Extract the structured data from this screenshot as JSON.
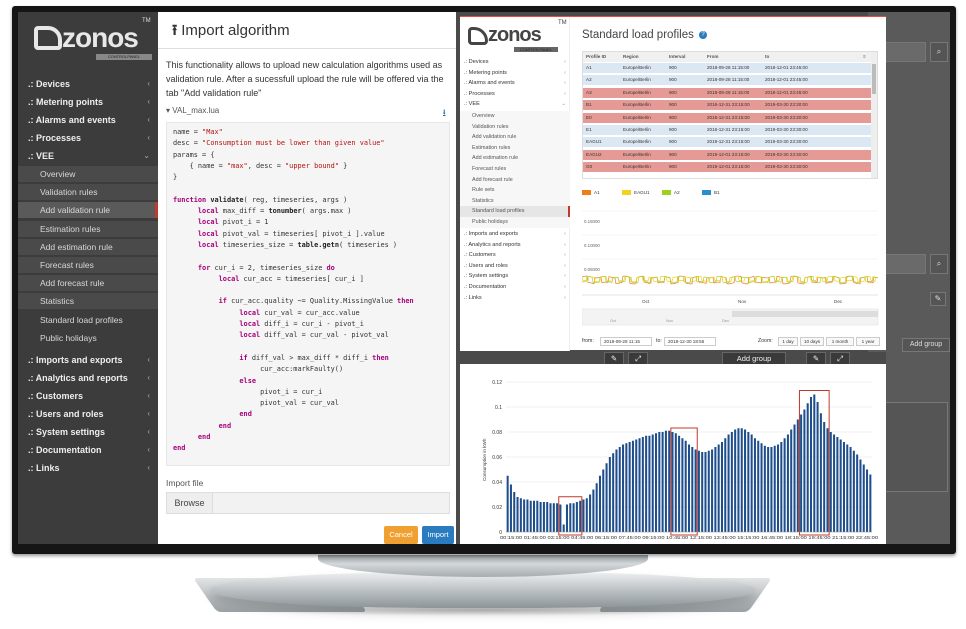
{
  "sidebar": {
    "brand": "zonos",
    "tm": "TM",
    "brand_sub": "CONTROLPANEL",
    "groups": [
      {
        "label": "Devices"
      },
      {
        "label": "Metering points"
      },
      {
        "label": "Alarms and events"
      },
      {
        "label": "Processes"
      },
      {
        "label": "VEE"
      }
    ],
    "vee_items": [
      "Overview",
      "Validation rules",
      "Add validation rule",
      "Estimation rules",
      "Add estimation rule",
      "Forecast rules",
      "Add forecast rule",
      "Statistics",
      "Standard load profiles",
      "Public holidays"
    ],
    "lower_groups": [
      "Imports and exports",
      "Analytics and reports",
      "Customers",
      "Users and roles",
      "System settings",
      "Documentation",
      "Links"
    ]
  },
  "modal": {
    "title": "Import algorithm",
    "description": "This functionality allows to upload new calculation algorithms used as validation rule. After a sucessfull upload the rule will be offered via the tab \"Add validation rule\"",
    "file_name": "VAL_max.lua",
    "import_file_label": "Import file",
    "browse_label": "Browse",
    "cancel_label": "Cancel",
    "import_label": "Import"
  },
  "code_lines": [
    [
      [
        "",
        "name = "
      ],
      [
        "st",
        "\"Max\""
      ]
    ],
    [
      [
        "",
        "desc = "
      ],
      [
        "st",
        "\"Consumption must be lower than given value\""
      ]
    ],
    [
      [
        "",
        "params = {"
      ]
    ],
    [
      [
        "",
        "    { name = "
      ],
      [
        "st",
        "\"max\""
      ],
      [
        "",
        ", desc = "
      ],
      [
        "st",
        "\"upper bound\""
      ],
      [
        "",
        " }"
      ]
    ],
    [
      [
        "",
        "}"
      ]
    ],
    [
      [
        "",
        ""
      ]
    ],
    [
      [
        "kw",
        "function "
      ],
      [
        "fn",
        "validate"
      ],
      [
        "",
        "( reg, timeseries, args )"
      ]
    ],
    [
      [
        "",
        "      "
      ],
      [
        "kw",
        "local"
      ],
      [
        "",
        " max_diff = "
      ],
      [
        "fn",
        "tonumber"
      ],
      [
        "",
        "( args.max )"
      ]
    ],
    [
      [
        "",
        "      "
      ],
      [
        "kw",
        "local"
      ],
      [
        "",
        " pivot_i = 1"
      ]
    ],
    [
      [
        "",
        "      "
      ],
      [
        "kw",
        "local"
      ],
      [
        "",
        " pivot_val = timeseries[ pivot_i ].value"
      ]
    ],
    [
      [
        "",
        "      "
      ],
      [
        "kw",
        "local"
      ],
      [
        "",
        " timeseries_size = "
      ],
      [
        "fn",
        "table.getn"
      ],
      [
        "",
        "( timeseries )"
      ]
    ],
    [
      [
        "",
        ""
      ]
    ],
    [
      [
        "",
        "      "
      ],
      [
        "kw",
        "for"
      ],
      [
        "",
        " cur_i = 2, timeseries_size "
      ],
      [
        "kw",
        "do"
      ]
    ],
    [
      [
        "",
        "           "
      ],
      [
        "kw",
        "local"
      ],
      [
        "",
        " cur_acc = timeseries[ cur_i ]"
      ]
    ],
    [
      [
        "",
        ""
      ]
    ],
    [
      [
        "",
        "           "
      ],
      [
        "kw",
        "if"
      ],
      [
        "",
        " cur_acc.quality ~= Quality.MissingValue "
      ],
      [
        "kw",
        "then"
      ]
    ],
    [
      [
        "",
        "                "
      ],
      [
        "kw",
        "local"
      ],
      [
        "",
        " cur_val = cur_acc.value"
      ]
    ],
    [
      [
        "",
        "                "
      ],
      [
        "kw",
        "local"
      ],
      [
        "",
        " diff_i = cur_i - pivot_i"
      ]
    ],
    [
      [
        "",
        "                "
      ],
      [
        "kw",
        "local"
      ],
      [
        "",
        " diff_val = cur_val - pivot_val"
      ]
    ],
    [
      [
        "",
        ""
      ]
    ],
    [
      [
        "",
        "                "
      ],
      [
        "kw",
        "if"
      ],
      [
        "",
        " diff_val > max_diff * diff_i "
      ],
      [
        "kw",
        "then"
      ]
    ],
    [
      [
        "",
        "                     cur_acc:markFaulty()"
      ]
    ],
    [
      [
        "",
        "                "
      ],
      [
        "kw",
        "else"
      ]
    ],
    [
      [
        "",
        "                     pivot_i = cur_i"
      ]
    ],
    [
      [
        "",
        "                     pivot_val = cur_val"
      ]
    ],
    [
      [
        "",
        "                "
      ],
      [
        "kw",
        "end"
      ]
    ],
    [
      [
        "",
        "           "
      ],
      [
        "kw",
        "end"
      ]
    ],
    [
      [
        "",
        "      "
      ],
      [
        "kw",
        "end"
      ]
    ],
    [
      [
        "kw",
        "end"
      ]
    ]
  ],
  "slp": {
    "brand": "zonos",
    "brand_sub": "CONTROLPANEL",
    "title": "Standard load profiles",
    "info_glyph": "?",
    "menu_glyph": "≡",
    "nav": [
      "Devices",
      "Metering points",
      "Alarms and events",
      "Processes",
      "VEE"
    ],
    "vee_items": [
      "Overview",
      "Validation rules",
      "Add validation rule",
      "Estimation rules",
      "Add estimation rule",
      "Forecast rules",
      "Add forecast rule",
      "Rule sets",
      "Statistics",
      "Standard load profiles",
      "Public holidays"
    ],
    "lower_nav": [
      "Imports and exports",
      "Analytics and reports",
      "Customers",
      "Users and roles",
      "System settings",
      "Documentation",
      "Links"
    ],
    "table_headers": [
      "Profile ID",
      "Region",
      "Interval",
      "From",
      "to"
    ],
    "rows": [
      {
        "id": "A1",
        "region": "Europe/Berlin",
        "interval": "900",
        "from": "2018-09-28 11:15:00",
        "to": "2018-12-01 23:45:00",
        "color": "blue"
      },
      {
        "id": "A2",
        "region": "Europe/Berlin",
        "interval": "900",
        "from": "2018-09-28 11:15:00",
        "to": "2018-12-01 23:45:00",
        "color": "blue"
      },
      {
        "id": "A3",
        "region": "Europe/Berlin",
        "interval": "900",
        "from": "2018-09-28 11:15:00",
        "to": "2018-12-01 23:45:00",
        "color": "red"
      },
      {
        "id": "B1",
        "region": "Europe/Berlin",
        "interval": "900",
        "from": "2016-12-31 23:15:00",
        "to": "2019-03-30 23:30:00",
        "color": "red"
      },
      {
        "id": "E0",
        "region": "Europe/Berlin",
        "interval": "900",
        "from": "2016-12-31 23:15:00",
        "to": "2019-03-30 23:30:00",
        "color": "red"
      },
      {
        "id": "E1",
        "region": "Europe/Berlin",
        "interval": "900",
        "from": "2016-12-31 23:15:00",
        "to": "2019-03-30 23:30:00",
        "color": "blue"
      },
      {
        "id": "EAGU1",
        "region": "Europe/Berlin",
        "interval": "900",
        "from": "2019-12-31 23:15:00",
        "to": "2019-03-30 23:30:00",
        "color": "blue"
      },
      {
        "id": "EAGU2",
        "region": "Europe/Berlin",
        "interval": "900",
        "from": "2019-12-01 23:15:00",
        "to": "2019-03-30 23:30:00",
        "color": "red"
      },
      {
        "id": "G0",
        "region": "Europe/Berlin",
        "interval": "900",
        "from": "2019-12-01 23:15:00",
        "to": "2019-03-30 23:30:00",
        "color": "red"
      }
    ],
    "legend": [
      {
        "name": "A1",
        "color": "#f07c1c"
      },
      {
        "name": "EAGU1",
        "color": "#f5d21c"
      },
      {
        "name": "A2",
        "color": "#9ed020"
      },
      {
        "name": "B1",
        "color": "#2a8fd0"
      }
    ],
    "yticks": [
      "0.15000",
      "0.10000",
      "0.05000"
    ],
    "months": [
      "Oct",
      "Nov",
      "Dec"
    ],
    "nav_months": [
      "Oct",
      "Nov",
      "Dec"
    ],
    "from_label": "from:",
    "from_value": "2018-09-28 11:15",
    "to_label": "to:",
    "to_value": "2018-12-30 18:55",
    "zoom_label": "Zoom:",
    "zoom_buttons": [
      "1 day",
      "10 days",
      "1 month",
      "1 year"
    ]
  },
  "bg_right": {
    "search_placeholder": "ch",
    "add_group_label": "Add group",
    "search_glyph": "⌕",
    "edit_glyph": "✎",
    "expand_glyph": "⤢"
  },
  "chart_data": {
    "type": "bar",
    "ylabel": "Consumption in kWh",
    "ylim": [
      0,
      0.12
    ],
    "yticks": [
      "0.12",
      "0.1",
      "0.08",
      "0.06",
      "0.04",
      "0.02",
      "0"
    ],
    "xtick_labels": "00:15:00 01:45:00 03:15:00 04:45:00 06:15:00 07:45:00 09:15:00 10:45:00 12:15:00 13:45:00 15:15:00 16:45:00 18:15:00 19:45:00 21:15:00 22:45:00",
    "values": [
      0.045,
      0.038,
      0.032,
      0.028,
      0.027,
      0.026,
      0.026,
      0.025,
      0.025,
      0.025,
      0.024,
      0.024,
      0.024,
      0.023,
      0.023,
      0.023,
      0.022,
      0.006,
      0.022,
      0.023,
      0.023,
      0.024,
      0.025,
      0.026,
      0.027,
      0.03,
      0.034,
      0.039,
      0.045,
      0.05,
      0.055,
      0.06,
      0.063,
      0.066,
      0.068,
      0.07,
      0.071,
      0.072,
      0.073,
      0.074,
      0.075,
      0.076,
      0.077,
      0.077,
      0.078,
      0.079,
      0.08,
      0.08,
      0.081,
      0.081,
      0.08,
      0.079,
      0.077,
      0.075,
      0.073,
      0.07,
      0.068,
      0.066,
      0.065,
      0.064,
      0.064,
      0.065,
      0.066,
      0.068,
      0.07,
      0.072,
      0.075,
      0.078,
      0.08,
      0.082,
      0.083,
      0.083,
      0.082,
      0.08,
      0.078,
      0.075,
      0.073,
      0.071,
      0.069,
      0.068,
      0.068,
      0.069,
      0.07,
      0.072,
      0.075,
      0.078,
      0.082,
      0.086,
      0.09,
      0.094,
      0.098,
      0.103,
      0.108,
      0.11,
      0.104,
      0.095,
      0.088,
      0.083,
      0.08,
      0.078,
      0.076,
      0.074,
      0.072,
      0.07,
      0.068,
      0.065,
      0.062,
      0.058,
      0.054,
      0.05,
      0.046
    ],
    "highlights": [
      [
        16,
        22
      ],
      [
        50,
        57
      ],
      [
        89,
        97
      ]
    ],
    "bar_color": "#1f4e8c",
    "highlight_color": "#c0392b"
  }
}
